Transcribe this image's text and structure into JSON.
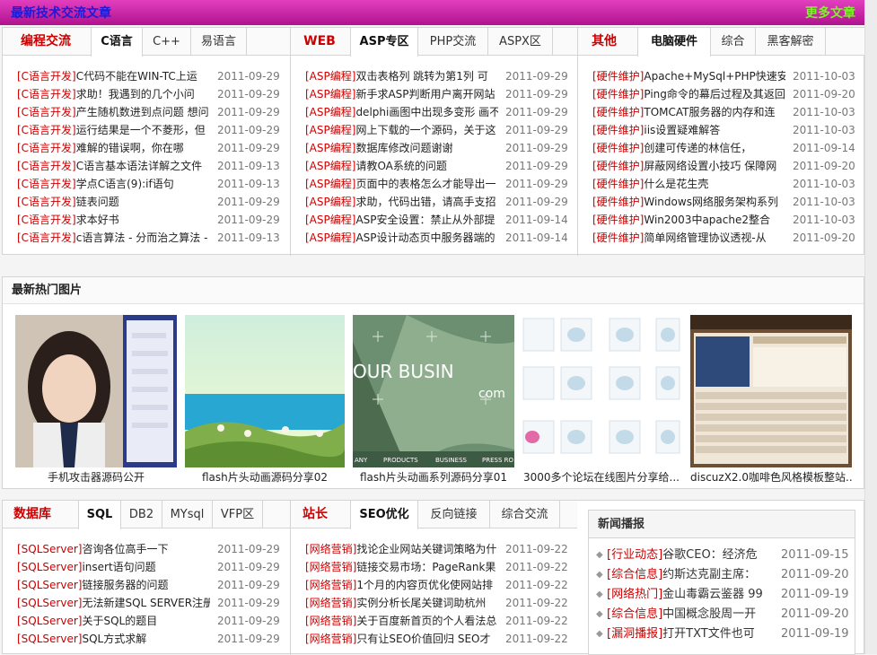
{
  "topbar": {
    "title": "最新技术交流文章",
    "more": "更多文章"
  },
  "panels": [
    {
      "tabs": [
        "编程交流",
        "C语言",
        "C++",
        "易语言"
      ],
      "items": [
        {
          "cat": "[C语言开发]",
          "text": "C代码不能在WIN-TC上运",
          "date": "2011-09-29"
        },
        {
          "cat": "[C语言开发]",
          "text": "求助！我遇到的几个小问",
          "date": "2011-09-29"
        },
        {
          "cat": "[C语言开发]",
          "text": "产生随机数进到点问题 想问",
          "date": "2011-09-29"
        },
        {
          "cat": "[C语言开发]",
          "text": "运行结果是一个不菱形，但",
          "date": "2011-09-29"
        },
        {
          "cat": "[C语言开发]",
          "text": "难解的错误啊，你在哪",
          "date": "2011-09-29"
        },
        {
          "cat": "[C语言开发]",
          "text": "C语言基本语法详解之文件",
          "date": "2011-09-13"
        },
        {
          "cat": "[C语言开发]",
          "text": "学点C语言(9):if语句",
          "date": "2011-09-13"
        },
        {
          "cat": "[C语言开发]",
          "text": "链表问题",
          "date": "2011-09-29"
        },
        {
          "cat": "[C语言开发]",
          "text": "求本好书",
          "date": "2011-09-29"
        },
        {
          "cat": "[C语言开发]",
          "text": "c语言算法 - 分而治之算法 -",
          "date": "2011-09-13"
        }
      ]
    },
    {
      "tabs": [
        "WEB",
        "ASP专区",
        "PHP交流",
        "ASPX区"
      ],
      "items": [
        {
          "cat": "[ASP编程]",
          "text": "双击表格列 跳转为第1列 可",
          "date": "2011-09-29"
        },
        {
          "cat": "[ASP编程]",
          "text": "新手求ASP判断用户离开网站",
          "date": "2011-09-29"
        },
        {
          "cat": "[ASP编程]",
          "text": "delphi画图中出现多变形 画不",
          "date": "2011-09-29"
        },
        {
          "cat": "[ASP编程]",
          "text": "网上下载的一个源码，关于这",
          "date": "2011-09-29"
        },
        {
          "cat": "[ASP编程]",
          "text": "数据库修改问题谢谢",
          "date": "2011-09-29"
        },
        {
          "cat": "[ASP编程]",
          "text": "请教OA系统的问题",
          "date": "2011-09-29"
        },
        {
          "cat": "[ASP编程]",
          "text": "页面中的表格怎么才能导出一",
          "date": "2011-09-29"
        },
        {
          "cat": "[ASP编程]",
          "text": "求助，代码出错，请高手支招",
          "date": "2011-09-29"
        },
        {
          "cat": "[ASP编程]",
          "text": "ASP安全设置：禁止从外部提",
          "date": "2011-09-14"
        },
        {
          "cat": "[ASP编程]",
          "text": "ASP设计动态页中服务器端的",
          "date": "2011-09-14"
        }
      ]
    },
    {
      "tabs": [
        "其他",
        "电脑硬件",
        "综合",
        "黑客解密"
      ],
      "items": [
        {
          "cat": "[硬件维护]",
          "text": "Apache+MySql+PHP快速安",
          "date": "2011-10-03"
        },
        {
          "cat": "[硬件维护]",
          "text": "Ping命令的幕后过程及其返回",
          "date": "2011-09-20"
        },
        {
          "cat": "[硬件维护]",
          "text": "TOMCAT服务器的内存和连",
          "date": "2011-10-03"
        },
        {
          "cat": "[硬件维护]",
          "text": "iis设置疑难解答",
          "date": "2011-10-03"
        },
        {
          "cat": "[硬件维护]",
          "text": "创建可传递的林信任，",
          "date": "2011-09-14"
        },
        {
          "cat": "[硬件维护]",
          "text": "屏蔽网络设置小技巧 保障网",
          "date": "2011-09-20"
        },
        {
          "cat": "[硬件维护]",
          "text": "什么是花生壳",
          "date": "2011-10-03"
        },
        {
          "cat": "[硬件维护]",
          "text": "Windows网络服务架构系列",
          "date": "2011-10-03"
        },
        {
          "cat": "[硬件维护]",
          "text": "Win2003中apache2整合",
          "date": "2011-10-03"
        },
        {
          "cat": "[硬件维护]",
          "text": "简单网络管理协议透视-从",
          "date": "2011-09-20"
        }
      ]
    }
  ],
  "images": {
    "heading": "最新热门图片",
    "items": [
      {
        "caption": "手机攻击器源码公开"
      },
      {
        "caption": "flash片头动画源码分享02"
      },
      {
        "caption": "flash片头动画系列源码分享01",
        "overlay": "OUR BUSIN",
        "overlay2": "com",
        "footer": [
          "ANY",
          "PRODUCTS",
          "BUSINESS",
          "PRESS RO"
        ]
      },
      {
        "caption": "3000多个论坛在线图片分享给..."
      },
      {
        "caption": "discuzX2.0咖啡色风格模板整站..."
      }
    ]
  },
  "panels2": [
    {
      "tabs": [
        "数据库",
        "SQL",
        "DB2",
        "MYsql",
        "VFP区"
      ],
      "items": [
        {
          "cat": "[SQLServer]",
          "text": "咨询各位高手一下",
          "date": "2011-09-29"
        },
        {
          "cat": "[SQLServer]",
          "text": "insert语句问题",
          "date": "2011-09-29"
        },
        {
          "cat": "[SQLServer]",
          "text": "链接服务器的问题",
          "date": "2011-09-29"
        },
        {
          "cat": "[SQLServer]",
          "text": "无法新建SQL SERVER注册",
          "date": "2011-09-29"
        },
        {
          "cat": "[SQLServer]",
          "text": "关于SQL的题目",
          "date": "2011-09-29"
        },
        {
          "cat": "[SQLServer]",
          "text": "SQL方式求解",
          "date": "2011-09-29"
        }
      ]
    },
    {
      "tabs": [
        "站长",
        "SEO优化",
        "反向链接",
        "综合交流"
      ],
      "items": [
        {
          "cat": "[网络营销]",
          "text": "找论企业网站关键词策略为什",
          "date": "2011-09-22"
        },
        {
          "cat": "[网络营销]",
          "text": "链接交易市场：PageRank果",
          "date": "2011-09-22"
        },
        {
          "cat": "[网络营销]",
          "text": "1个月的内容页优化使网站排",
          "date": "2011-09-22"
        },
        {
          "cat": "[网络营销]",
          "text": "实例分析长尾关键词助杭州",
          "date": "2011-09-22"
        },
        {
          "cat": "[网络营销]",
          "text": "关于百度新首页的个人看法总",
          "date": "2011-09-22"
        },
        {
          "cat": "[网络营销]",
          "text": "只有让SEO价值回归 SEO才",
          "date": "2011-09-22"
        }
      ]
    }
  ],
  "news": {
    "heading": "新闻播报",
    "items": [
      {
        "cat": "[行业动态]",
        "text": "谷歌CEO：经济危",
        "date": "2011-09-15"
      },
      {
        "cat": "[综合信息]",
        "text": "约斯达克副主席：",
        "date": "2011-09-20"
      },
      {
        "cat": "[网络热门]",
        "text": "金山毒霸云鉴器 99",
        "date": "2011-09-19"
      },
      {
        "cat": "[综合信息]",
        "text": "中国概念股周一开",
        "date": "2011-09-20"
      },
      {
        "cat": "[漏洞播报]",
        "text": "打开TXT文件也可",
        "date": "2011-09-19"
      }
    ]
  },
  "colors": {
    "accent": "#c00000",
    "topbar": "#c01a9c",
    "title": "#1b1bd8",
    "more": "#7ff02e"
  }
}
